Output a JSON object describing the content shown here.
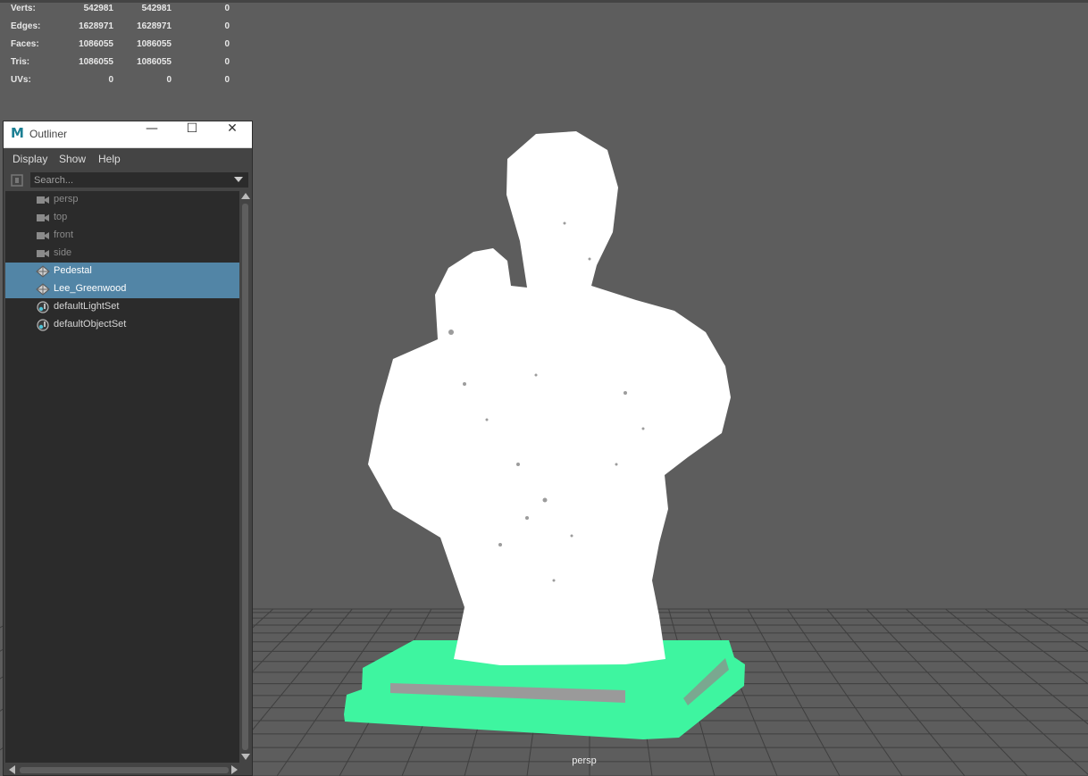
{
  "hud": {
    "rows": [
      {
        "label": "Verts:",
        "v1": "542981",
        "v2": "542981",
        "v3": "0"
      },
      {
        "label": "Edges:",
        "v1": "1628971",
        "v2": "1628971",
        "v3": "0"
      },
      {
        "label": "Faces:",
        "v1": "1086055",
        "v2": "1086055",
        "v3": "0"
      },
      {
        "label": "Tris:",
        "v1": "1086055",
        "v2": "1086055",
        "v3": "0"
      },
      {
        "label": "UVs:",
        "v1": "0",
        "v2": "0",
        "v3": "0"
      }
    ]
  },
  "viewport": {
    "camera_label": "persp",
    "colors": {
      "background": "#5d5d5d",
      "grid": "#3e3e3e",
      "model": "#ffffff",
      "pedestal": "#3ef5a0"
    }
  },
  "outliner": {
    "title": "Outliner",
    "icons": {
      "app": "maya-logo-icon",
      "minimize": "minimize-icon",
      "maximize": "maximize-icon",
      "close": "close-icon"
    },
    "menu": [
      "Display",
      "Show",
      "Help"
    ],
    "search": {
      "placeholder": "Search...",
      "value": ""
    },
    "selection_color": "#5285a6",
    "items": [
      {
        "label": "persp",
        "icon": "camera-icon",
        "state": "dim"
      },
      {
        "label": "top",
        "icon": "camera-icon",
        "state": "dim"
      },
      {
        "label": "front",
        "icon": "camera-icon",
        "state": "dim"
      },
      {
        "label": "side",
        "icon": "camera-icon",
        "state": "dim"
      },
      {
        "label": "Pedestal",
        "icon": "mesh-icon",
        "state": "selected"
      },
      {
        "label": "Lee_Greenwood",
        "icon": "mesh-icon",
        "state": "selected"
      },
      {
        "label": "defaultLightSet",
        "icon": "set-icon",
        "state": "normal"
      },
      {
        "label": "defaultObjectSet",
        "icon": "set-icon",
        "state": "normal"
      }
    ]
  }
}
